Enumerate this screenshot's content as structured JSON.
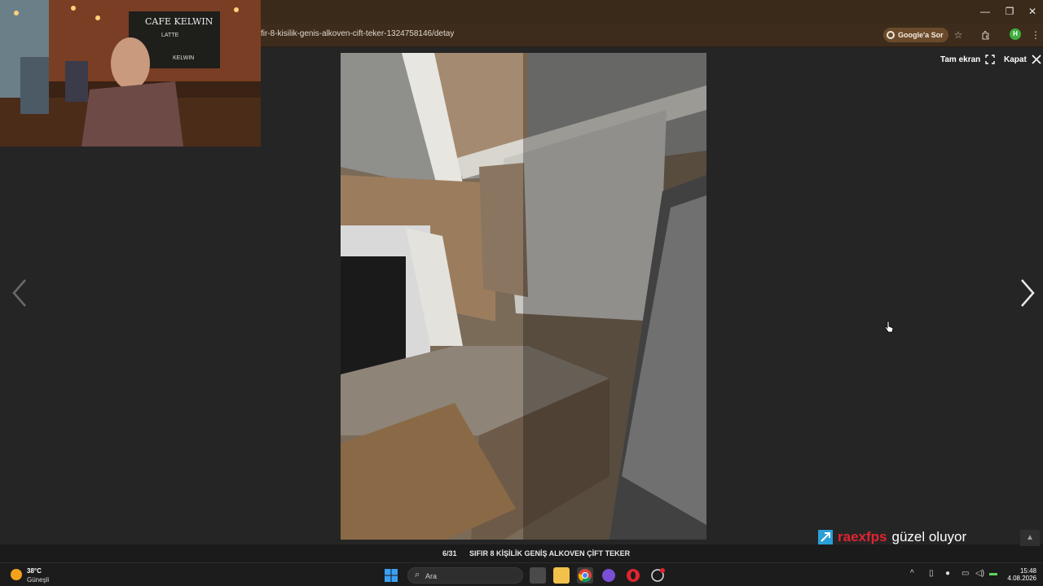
{
  "browser": {
    "url": "fir-8-kisilik-genis-alkoven-cift-teker-1324758146/detay",
    "google_button": "Google'a Sor",
    "window_controls": {
      "minimize": "—",
      "maximize": "❐",
      "close": "✕"
    },
    "icons": [
      "star-icon",
      "extensions-icon",
      "profile-avatar",
      "menu-dots-icon"
    ],
    "profile_initial": "H"
  },
  "viewer": {
    "fullscreen_label": "Tam ekran",
    "close_label": "Kapat",
    "counter": "6/31",
    "caption": "SIFIR 8 KİŞİLİK GENİŞ ALKOVEN ÇİFT TEKER",
    "prev_icon": "chevron-left-icon",
    "next_icon": "chevron-right-icon"
  },
  "overlay": {
    "name": "raexfps",
    "message": "güzel oluyor"
  },
  "webcam": {
    "sign_text": "CAFE KELWIN",
    "menu_line_1": "LATTE",
    "menu_line_2": "KELWIN"
  },
  "taskbar": {
    "temperature": "38°C",
    "condition": "Güneşli",
    "search_placeholder": "Ara",
    "time": "15:48",
    "date": "4.08.2026"
  }
}
